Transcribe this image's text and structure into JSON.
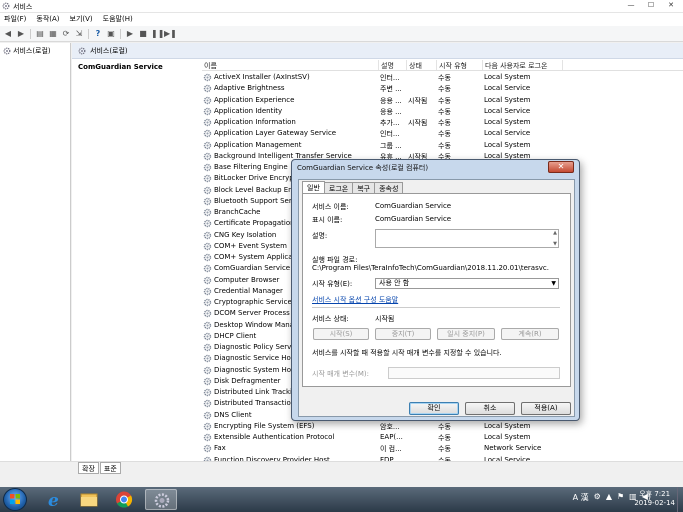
{
  "window": {
    "title": "서비스"
  },
  "menu": [
    "파일(F)",
    "동작(A)",
    "보기(V)",
    "도움말(H)"
  ],
  "left_pane": {
    "tree_item": "서비스(로컬)"
  },
  "right_pane": {
    "header": "서비스(로컬)",
    "selected_service": "ComGuardian Service",
    "columns": [
      "이름",
      "설명",
      "상태",
      "시작 유형",
      "다음 사용자로 로그온"
    ],
    "rows": [
      {
        "name": "ActiveX Installer (AxInstSV)",
        "desc": "인터...",
        "status": "",
        "start": "수동",
        "logon": "Local System"
      },
      {
        "name": "Adaptive Brightness",
        "desc": "주변 ...",
        "status": "",
        "start": "수동",
        "logon": "Local Service"
      },
      {
        "name": "Application Experience",
        "desc": "응용 ...",
        "status": "시작됨",
        "start": "수동",
        "logon": "Local System"
      },
      {
        "name": "Application Identity",
        "desc": "응용 ...",
        "status": "",
        "start": "수동",
        "logon": "Local Service"
      },
      {
        "name": "Application Information",
        "desc": "추가...",
        "status": "시작됨",
        "start": "수동",
        "logon": "Local System"
      },
      {
        "name": "Application Layer Gateway Service",
        "desc": "인터...",
        "status": "",
        "start": "수동",
        "logon": "Local Service"
      },
      {
        "name": "Application Management",
        "desc": "그룹 ...",
        "status": "",
        "start": "수동",
        "logon": "Local System"
      },
      {
        "name": "Background Intelligent Transfer Service",
        "desc": "유휴 ...",
        "status": "시작됨",
        "start": "수동",
        "logon": "Local System"
      },
      {
        "name": "Base Filtering Engine",
        "desc": "",
        "status": "",
        "start": "",
        "logon": ""
      },
      {
        "name": "BitLocker Drive Encryption Service",
        "desc": "",
        "status": "",
        "start": "",
        "logon": ""
      },
      {
        "name": "Block Level Backup Engine Service",
        "desc": "",
        "status": "",
        "start": "",
        "logon": ""
      },
      {
        "name": "Bluetooth Support Service",
        "desc": "",
        "status": "",
        "start": "",
        "logon": ""
      },
      {
        "name": "BranchCache",
        "desc": "",
        "status": "",
        "start": "",
        "logon": ""
      },
      {
        "name": "Certificate Propagation",
        "desc": "",
        "status": "",
        "start": "",
        "logon": ""
      },
      {
        "name": "CNG Key Isolation",
        "desc": "",
        "status": "",
        "start": "",
        "logon": ""
      },
      {
        "name": "COM+ Event System",
        "desc": "",
        "status": "",
        "start": "",
        "logon": ""
      },
      {
        "name": "COM+ System Application",
        "desc": "",
        "status": "",
        "start": "",
        "logon": ""
      },
      {
        "name": "ComGuardian Service",
        "desc": "",
        "status": "",
        "start": "",
        "logon": ""
      },
      {
        "name": "Computer Browser",
        "desc": "",
        "status": "",
        "start": "",
        "logon": ""
      },
      {
        "name": "Credential Manager",
        "desc": "",
        "status": "",
        "start": "",
        "logon": ""
      },
      {
        "name": "Cryptographic Services",
        "desc": "",
        "status": "",
        "start": "",
        "logon": ""
      },
      {
        "name": "DCOM Server Process Launcher",
        "desc": "",
        "status": "",
        "start": "",
        "logon": ""
      },
      {
        "name": "Desktop Window Manager Session Manager",
        "desc": "",
        "status": "",
        "start": "",
        "logon": ""
      },
      {
        "name": "DHCP Client",
        "desc": "",
        "status": "",
        "start": "",
        "logon": ""
      },
      {
        "name": "Diagnostic Policy Service",
        "desc": "",
        "status": "",
        "start": "",
        "logon": ""
      },
      {
        "name": "Diagnostic Service Host",
        "desc": "",
        "status": "",
        "start": "",
        "logon": ""
      },
      {
        "name": "Diagnostic System Host",
        "desc": "",
        "status": "",
        "start": "",
        "logon": ""
      },
      {
        "name": "Disk Defragmenter",
        "desc": "",
        "status": "",
        "start": "",
        "logon": ""
      },
      {
        "name": "Distributed Link Tracking Client",
        "desc": "",
        "status": "",
        "start": "",
        "logon": ""
      },
      {
        "name": "Distributed Transaction Coordinator",
        "desc": "",
        "status": "",
        "start": "",
        "logon": ""
      },
      {
        "name": "DNS Client",
        "desc": "",
        "status": "",
        "start": "",
        "logon": ""
      },
      {
        "name": "Encrypting File System (EFS)",
        "desc": "암호...",
        "status": "",
        "start": "수동",
        "logon": "Local System"
      },
      {
        "name": "Extensible Authentication Protocol",
        "desc": "EAP(...",
        "status": "",
        "start": "수동",
        "logon": "Local System"
      },
      {
        "name": "Fax",
        "desc": "이 컴...",
        "status": "",
        "start": "수동",
        "logon": "Network Service"
      },
      {
        "name": "Function Discovery Provider Host",
        "desc": "FDP...",
        "status": "",
        "start": "수동",
        "logon": "Local Service"
      }
    ]
  },
  "bottom_tabs": [
    "확장",
    "표준"
  ],
  "dialog": {
    "title": "ComGuardian Service 속성(로컬 컴퓨터)",
    "close": "✕",
    "tabs": [
      "일반",
      "로그온",
      "복구",
      "종속성"
    ],
    "service_name_label": "서비스 이름:",
    "service_name": "ComGuardian Service",
    "display_name_label": "표시 이름:",
    "display_name": "ComGuardian Service",
    "description_label": "설명:",
    "path_label": "실행 파일 경로:",
    "path": "C:\\Program Files\\TeraInfoTech\\ComGuardian\\2018.11.20.01\\terasvc.",
    "startup_type_label": "시작 유형(E):",
    "startup_type": "사용 안 함",
    "help_link": "서비스 시작 옵션 구성 도움말",
    "status_label": "서비스 상태:",
    "status": "시작됨",
    "btn_start": "시작(S)",
    "btn_stop": "중지(T)",
    "btn_pause": "일시 중지(P)",
    "btn_resume": "계속(R)",
    "hint": "서비스를 시작할 때 적용할 시작 매개 변수를 지정할 수 있습니다.",
    "params_label": "시작 매개 변수(M):",
    "ok": "확인",
    "cancel": "취소",
    "apply": "적용(A)"
  },
  "taskbar": {
    "lang": "A 漢",
    "time": "오후 7:21",
    "date": "2019-02-14"
  }
}
